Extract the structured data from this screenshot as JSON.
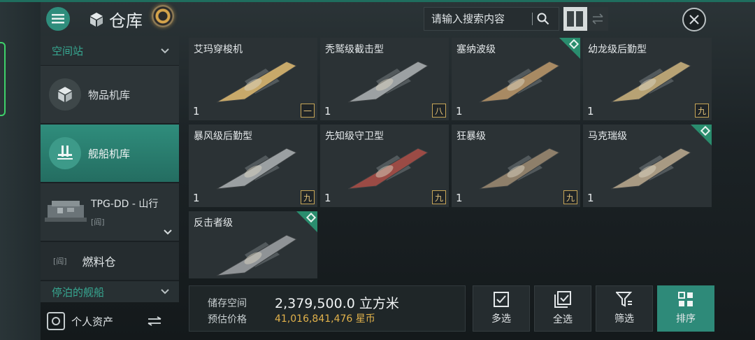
{
  "header": {
    "title": "仓库",
    "search_placeholder": "请输入搜索内容"
  },
  "sidebar": {
    "section_station": "空间站",
    "items": [
      {
        "label": "物品机库"
      },
      {
        "label": "舰船机库"
      }
    ],
    "station": {
      "name": "TPG-DD - 山行",
      "sub": "[阎]"
    },
    "fuel_label": "燃料仓",
    "fuel_badge": "[阎]",
    "docked_label": "停泊的舰船",
    "personal_assets": "个人资产"
  },
  "ships": [
    {
      "name": "艾玛穿梭机",
      "qty": "1",
      "tier": "一",
      "corner": false,
      "color": "#c8a96a"
    },
    {
      "name": "秃鹫级截击型",
      "qty": "1",
      "tier": "八",
      "corner": false,
      "color": "#9ca1a3"
    },
    {
      "name": "塞纳波级",
      "qty": "1",
      "tier": "",
      "corner": true,
      "color": "#a88a63"
    },
    {
      "name": "幼龙级后勤型",
      "qty": "1",
      "tier": "九",
      "corner": false,
      "color": "#b7a274"
    },
    {
      "name": "暴风级后勤型",
      "qty": "1",
      "tier": "九",
      "corner": false,
      "color": "#9ba0a2"
    },
    {
      "name": "先知级守卫型",
      "qty": "1",
      "tier": "九",
      "corner": false,
      "color": "#9b4b45"
    },
    {
      "name": "狂暴级",
      "qty": "1",
      "tier": "九",
      "corner": false,
      "color": "#8e7f6a"
    },
    {
      "name": "马克瑞级",
      "qty": "1",
      "tier": "",
      "corner": true,
      "color": "#a89a83"
    },
    {
      "name": "反击者级",
      "qty": "",
      "tier": "",
      "corner": true,
      "color": "#8f9396"
    }
  ],
  "stats": {
    "storage_label": "储存空间",
    "storage_value": "2,379,500.0 立方米",
    "price_label": "预估价格",
    "price_value": "41,016,841,476 星币"
  },
  "actions": {
    "multi": "多选",
    "all": "全选",
    "filter": "筛选",
    "sort": "排序"
  },
  "colors": {
    "accent": "#2f8d7c",
    "gold": "#e2b24b",
    "section_text": "#37a892"
  }
}
